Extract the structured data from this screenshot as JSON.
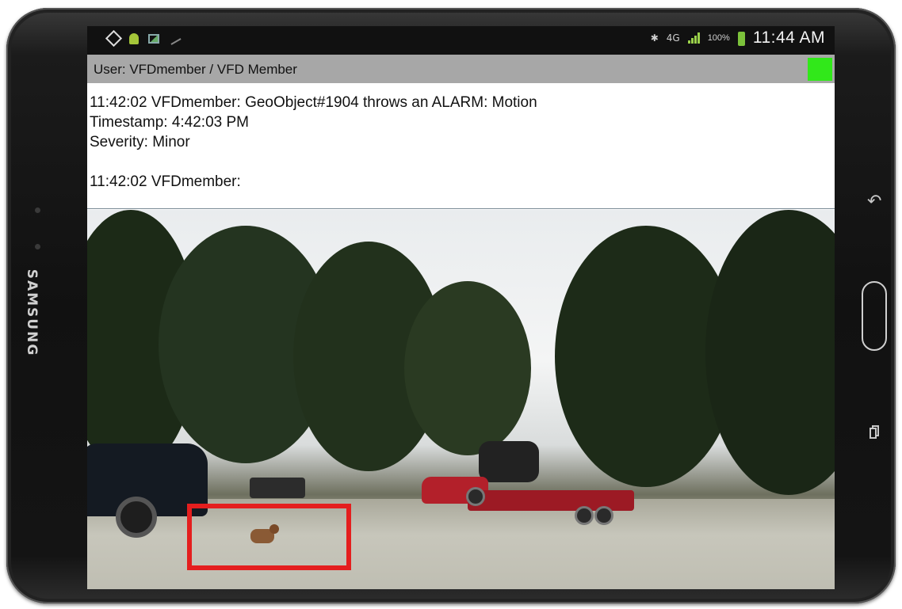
{
  "device": {
    "brand": "SAMSUNG"
  },
  "status_bar": {
    "network_label": "4G",
    "battery": "100%",
    "time": "11:44 AM",
    "icons": [
      "location-diamond-icon",
      "android-icon",
      "gallery-icon",
      "satellite-icon",
      "bluetooth-icon",
      "network-icon",
      "signal-icon",
      "battery-icon"
    ]
  },
  "user_bar": {
    "label": "User:  VFDmember / VFD Member",
    "status_color": "#31e81a"
  },
  "messages": {
    "line1": "11:42:02 VFDmember: GeoObject#1904 throws an ALARM: Motion",
    "line2": "Timestamp: 4:42:03 PM",
    "line3": "Severity: Minor",
    "line4": "11:42:02 VFDmember:"
  },
  "colors": {
    "detection_box": "#e41e1e",
    "userbar_bg": "#a7a7a7"
  }
}
